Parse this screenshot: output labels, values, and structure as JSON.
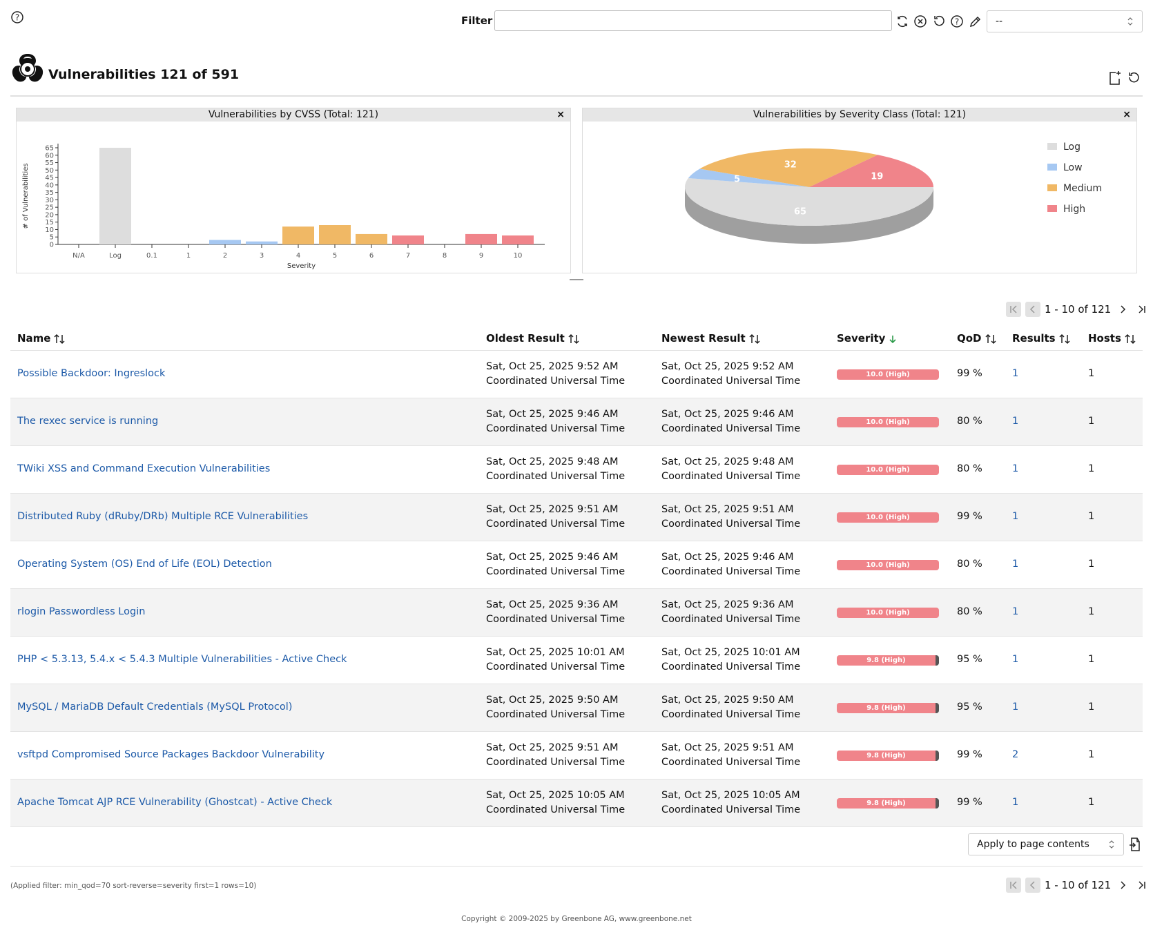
{
  "header": {
    "filter_label": "Filter",
    "filter_value": "",
    "filter_select_value": "--"
  },
  "page": {
    "title": "Vulnerabilities 121 of 591"
  },
  "bar_panel": {
    "title": "Vulnerabilities by CVSS (Total: 121)",
    "close": "×"
  },
  "pie_panel": {
    "title": "Vulnerabilities by Severity Class (Total: 121)",
    "close": "×"
  },
  "chart_data": [
    {
      "type": "bar",
      "title": "Vulnerabilities by CVSS (Total: 121)",
      "xlabel": "Severity",
      "ylabel": "# of Vulnerabilities",
      "categories": [
        "N/A",
        "Log",
        "0.1",
        "1",
        "2",
        "3",
        "4",
        "5",
        "6",
        "7",
        "8",
        "9",
        "10"
      ],
      "values": [
        0,
        65,
        0,
        0,
        3,
        2,
        12,
        13,
        7,
        6,
        0,
        7,
        6
      ],
      "colors": [
        "#dddddd",
        "#dddddd",
        "#a6c8f2",
        "#a6c8f2",
        "#a6c8f2",
        "#a6c8f2",
        "#f0b865",
        "#f0b865",
        "#f0b865",
        "#f0848a",
        "#f0848a",
        "#f0848a",
        "#f0848a"
      ],
      "yticks": [
        0,
        5,
        10,
        15,
        20,
        25,
        30,
        35,
        40,
        45,
        50,
        55,
        60,
        65
      ],
      "ylim": [
        0,
        65
      ]
    },
    {
      "type": "pie",
      "title": "Vulnerabilities by Severity Class (Total: 121)",
      "slices": [
        {
          "label": "Log",
          "value": 65,
          "color": "#dddddd"
        },
        {
          "label": "Low",
          "value": 5,
          "color": "#a6c8f2"
        },
        {
          "label": "Medium",
          "value": 32,
          "color": "#f0b865"
        },
        {
          "label": "High",
          "value": 19,
          "color": "#f0848a"
        }
      ],
      "legend_position": "right"
    }
  ],
  "pagination": {
    "text": "1 - 10 of 121"
  },
  "table": {
    "headers": {
      "name": "Name",
      "oldest": "Oldest Result",
      "newest": "Newest Result",
      "severity": "Severity",
      "qod": "QoD",
      "results": "Results",
      "hosts": "Hosts"
    },
    "rows": [
      {
        "name": "Possible Backdoor: Ingreslock",
        "oldest_date": "Sat, Oct 25, 2025 9:52 AM",
        "oldest_tz": "Coordinated Universal Time",
        "newest_date": "Sat, Oct 25, 2025 9:52 AM",
        "newest_tz": "Coordinated Universal Time",
        "severity": "10.0 (High)",
        "severity_score": 10.0,
        "qod": "99 %",
        "results": "1",
        "hosts": "1"
      },
      {
        "name": "The rexec service is running",
        "oldest_date": "Sat, Oct 25, 2025 9:46 AM",
        "oldest_tz": "Coordinated Universal Time",
        "newest_date": "Sat, Oct 25, 2025 9:46 AM",
        "newest_tz": "Coordinated Universal Time",
        "severity": "10.0 (High)",
        "severity_score": 10.0,
        "qod": "80 %",
        "results": "1",
        "hosts": "1"
      },
      {
        "name": "TWiki XSS and Command Execution Vulnerabilities",
        "oldest_date": "Sat, Oct 25, 2025 9:48 AM",
        "oldest_tz": "Coordinated Universal Time",
        "newest_date": "Sat, Oct 25, 2025 9:48 AM",
        "newest_tz": "Coordinated Universal Time",
        "severity": "10.0 (High)",
        "severity_score": 10.0,
        "qod": "80 %",
        "results": "1",
        "hosts": "1"
      },
      {
        "name": "Distributed Ruby (dRuby/DRb) Multiple RCE Vulnerabilities",
        "oldest_date": "Sat, Oct 25, 2025 9:51 AM",
        "oldest_tz": "Coordinated Universal Time",
        "newest_date": "Sat, Oct 25, 2025 9:51 AM",
        "newest_tz": "Coordinated Universal Time",
        "severity": "10.0 (High)",
        "severity_score": 10.0,
        "qod": "99 %",
        "results": "1",
        "hosts": "1"
      },
      {
        "name": "Operating System (OS) End of Life (EOL) Detection",
        "oldest_date": "Sat, Oct 25, 2025 9:46 AM",
        "oldest_tz": "Coordinated Universal Time",
        "newest_date": "Sat, Oct 25, 2025 9:46 AM",
        "newest_tz": "Coordinated Universal Time",
        "severity": "10.0 (High)",
        "severity_score": 10.0,
        "qod": "80 %",
        "results": "1",
        "hosts": "1"
      },
      {
        "name": "rlogin Passwordless Login",
        "oldest_date": "Sat, Oct 25, 2025 9:36 AM",
        "oldest_tz": "Coordinated Universal Time",
        "newest_date": "Sat, Oct 25, 2025 9:36 AM",
        "newest_tz": "Coordinated Universal Time",
        "severity": "10.0 (High)",
        "severity_score": 10.0,
        "qod": "80 %",
        "results": "1",
        "hosts": "1"
      },
      {
        "name": "PHP < 5.3.13, 5.4.x < 5.4.3 Multiple Vulnerabilities - Active Check",
        "oldest_date": "Sat, Oct 25, 2025 10:01 AM",
        "oldest_tz": "Coordinated Universal Time",
        "newest_date": "Sat, Oct 25, 2025 10:01 AM",
        "newest_tz": "Coordinated Universal Time",
        "severity": "9.8 (High)",
        "severity_score": 9.8,
        "qod": "95 %",
        "results": "1",
        "hosts": "1"
      },
      {
        "name": "MySQL / MariaDB Default Credentials (MySQL Protocol)",
        "oldest_date": "Sat, Oct 25, 2025 9:50 AM",
        "oldest_tz": "Coordinated Universal Time",
        "newest_date": "Sat, Oct 25, 2025 9:50 AM",
        "newest_tz": "Coordinated Universal Time",
        "severity": "9.8 (High)",
        "severity_score": 9.8,
        "qod": "95 %",
        "results": "1",
        "hosts": "1"
      },
      {
        "name": "vsftpd Compromised Source Packages Backdoor Vulnerability",
        "oldest_date": "Sat, Oct 25, 2025 9:51 AM",
        "oldest_tz": "Coordinated Universal Time",
        "newest_date": "Sat, Oct 25, 2025 9:51 AM",
        "newest_tz": "Coordinated Universal Time",
        "severity": "9.8 (High)",
        "severity_score": 9.8,
        "qod": "99 %",
        "results": "2",
        "hosts": "1"
      },
      {
        "name": "Apache Tomcat AJP RCE Vulnerability (Ghostcat) - Active Check",
        "oldest_date": "Sat, Oct 25, 2025 10:05 AM",
        "oldest_tz": "Coordinated Universal Time",
        "newest_date": "Sat, Oct 25, 2025 10:05 AM",
        "newest_tz": "Coordinated Universal Time",
        "severity": "9.8 (High)",
        "severity_score": 9.8,
        "qod": "99 %",
        "results": "1",
        "hosts": "1"
      }
    ]
  },
  "footer_controls": {
    "apply_select": "Apply to page contents",
    "applied_filter": "(Applied filter: min_qod=70 sort-reverse=severity first=1 rows=10)",
    "copyright": "Copyright © 2009-2025 by Greenbone AG, www.greenbone.net"
  },
  "icons": {
    "help": "help-circle-icon",
    "refresh": "refresh-icon",
    "clear": "clear-filter-icon",
    "reset": "reset-icon",
    "filter_help": "filter-help-icon",
    "edit": "edit-filter-icon",
    "logo": "biohazard-icon",
    "new_dashboard": "new-dashboard-icon",
    "reset_dashboard": "reset-dashboard-icon",
    "export": "export-icon"
  }
}
